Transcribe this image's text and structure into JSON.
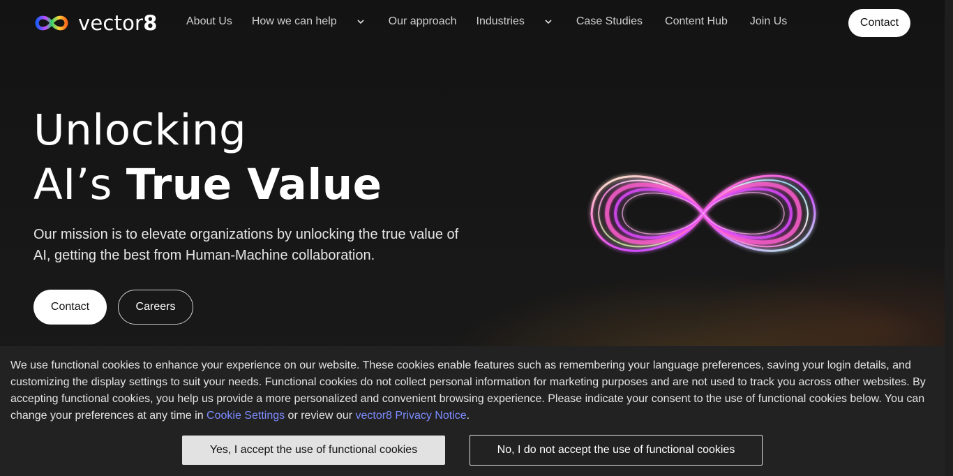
{
  "header": {
    "logo": {
      "text_light": "vector",
      "text_bold": "8",
      "colors": [
        "#1e5cff",
        "#2fd26b",
        "#ffd23a",
        "#ff6a1a",
        "#c44cff"
      ]
    },
    "nav": [
      {
        "label": "About Us",
        "has_dropdown": false
      },
      {
        "label": "How we can help",
        "has_dropdown": true
      },
      {
        "label": "Our approach",
        "has_dropdown": false
      },
      {
        "label": "Industries",
        "has_dropdown": true
      },
      {
        "label": "Case Studies",
        "has_dropdown": false
      },
      {
        "label": "Content Hub",
        "has_dropdown": false
      },
      {
        "label": "Join Us",
        "has_dropdown": false
      }
    ],
    "contact_label": "Contact"
  },
  "hero": {
    "title_line1": "Unlocking",
    "title_line2_light": "AI’s ",
    "title_line2_bold": "True Value",
    "description": "Our mission is to elevate organizations by unlocking the true value of AI, getting the best from Human-Machine collaboration.",
    "contact_button": "Contact",
    "careers_button": "Careers",
    "graphic_icon": "infinity-icon"
  },
  "cookie_banner": {
    "text_part1": "We use functional cookies to enhance your experience on our website. These cookies enable features such as remembering your language preferences, saving your login details, and customizing the display settings to suit your needs. Functional cookies do not collect personal information for marketing purposes and are not used to track you across other websites. By accepting functional cookies, you help us provide a more personalized and convenient browsing experience.  Please indicate your consent to the use of functional cookies below. You can change your preferences at any time in ",
    "link_settings": "Cookie Settings",
    "text_part2": " or review our ",
    "link_privacy": "vector8 Privacy Notice",
    "text_part3": ".",
    "accept_button": "Yes, I accept the use of functional cookies",
    "decline_button": "No, I do not accept the use of functional cookies",
    "link_color": "#7d8cff"
  }
}
